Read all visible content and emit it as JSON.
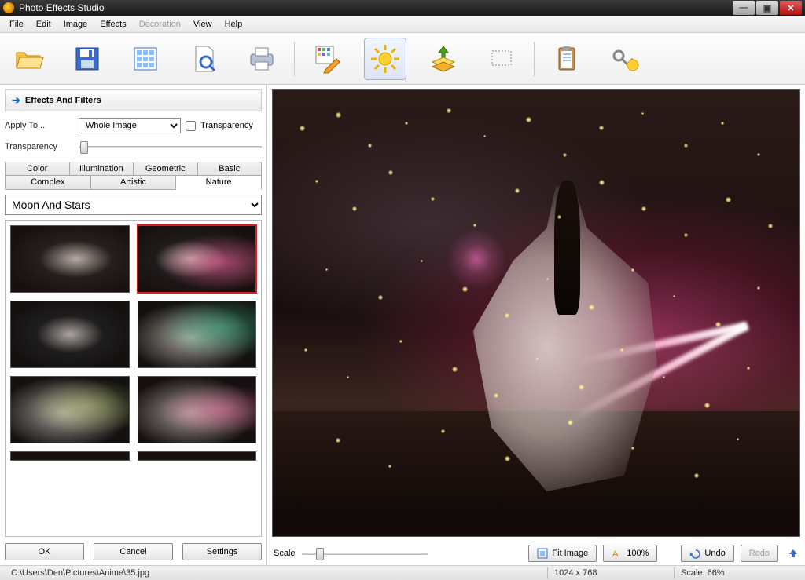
{
  "app": {
    "title": "Photo Effects Studio"
  },
  "menu": {
    "items": [
      "File",
      "Edit",
      "Image",
      "Effects",
      "Decoration",
      "View",
      "Help"
    ],
    "disabled_index": 4
  },
  "toolbar": {
    "buttons": [
      "open",
      "save",
      "gallery",
      "zoom",
      "print",
      "effects-grid",
      "sun-effect",
      "layers",
      "crop",
      "clipboard",
      "key-magic"
    ],
    "active_index": 6
  },
  "panel": {
    "title": "Effects And Filters",
    "apply_label": "Apply To...",
    "apply_value": "Whole Image",
    "transparency_checkbox": "Transparency",
    "transparency_label": "Transparency",
    "tabs_row1": [
      "Color",
      "Illumination",
      "Geometric",
      "Basic"
    ],
    "tabs_row2": [
      "Complex",
      "Artistic",
      "Nature"
    ],
    "active_tab": "Nature",
    "effect_select": "Moon And Stars",
    "thumbs_selected_index": 1,
    "buttons": {
      "ok": "OK",
      "cancel": "Cancel",
      "settings": "Settings"
    }
  },
  "canvas_footer": {
    "scale_label": "Scale",
    "fit": "Fit Image",
    "hundred": "100%",
    "undo": "Undo",
    "redo": "Redo"
  },
  "status": {
    "path": "C:\\Users\\Den\\Pictures\\Anime\\35.jpg",
    "dims": "1024 x 768",
    "scale": "Scale: 66%"
  }
}
